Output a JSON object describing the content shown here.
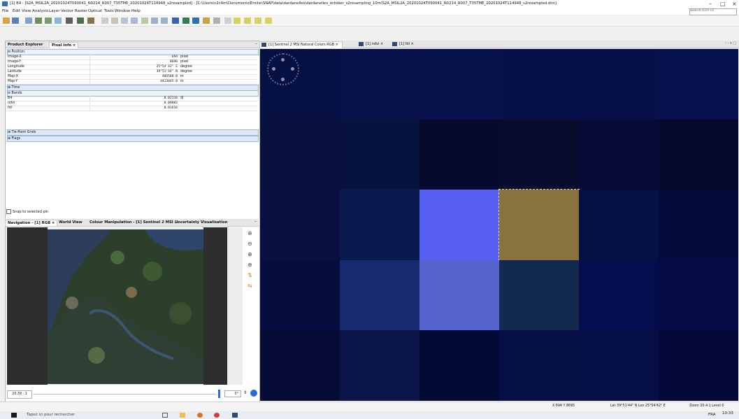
{
  "window": {
    "title": "[1] B4 - [S2A_MSIL2A_20201024T090041_N0214_R007_T35TME_20201024T114948_s2resampled] - [C:\\Users\\c2c4m\\Documents\\Emilie\\SNAP\\data\\dardanelles\\dardanelles_october_s2resampling_10m\\S2A_MSIL2A_20201024T090041_N0214_R007_T35TME_20201024T114948_s2resampled.dim]",
    "search_placeholder": "Search (Ctrl+I)"
  },
  "menu": [
    "File",
    "Edit",
    "View",
    "Analysis",
    "Layer",
    "Vector",
    "Raster",
    "Optical",
    "Tools",
    "Window",
    "Help"
  ],
  "left_panel": {
    "tabs": [
      "Product Explorer",
      "Pixel Info"
    ],
    "position_header": "Position",
    "position_rows": [
      {
        "name": "Image-X",
        "value": "694",
        "unit": "pixel"
      },
      {
        "name": "Image-Y",
        "value": "8696",
        "unit": "pixel"
      },
      {
        "name": "Longitude",
        "value": "25°54'42\" E",
        "unit": "degree"
      },
      {
        "name": "Latitude",
        "value": "39°51'44\" N",
        "unit": "degree"
      },
      {
        "name": "Map-X",
        "value": "406500.0",
        "unit": "m"
      },
      {
        "name": "Map-Y",
        "value": "4413045.0",
        "unit": "m"
      }
    ],
    "time_header": "Time",
    "bands_header": "Bands",
    "band_rows": [
      {
        "name": "B4",
        "value": "0.02110",
        "unit": "dl"
      },
      {
        "name": "ndvi",
        "value": "0.09082",
        "unit": ""
      },
      {
        "name": "fdi",
        "value": "0.01616",
        "unit": ""
      }
    ],
    "tiepoint_header": "Tie-Point Grids",
    "flags_header": "Flags",
    "snap_label": "Snap to selected pin"
  },
  "nav_panel": {
    "tabs": [
      "Navigation - [1] RGB",
      "World View",
      "Colour Manipulation - [1] Sentinel 2 MSI ...",
      "Uncertainty Visualisation"
    ],
    "scale": "20.39 : 1",
    "angle": "0°"
  },
  "image_tabs": [
    "[1] Sentinel 2 MSI Natural Colors RGB",
    "[1] ndvi",
    "[1] fdi"
  ],
  "pixel_grid": [
    [
      "#071043",
      "#08114a",
      "#08124a",
      "#071048",
      "#071049",
      "#081150"
    ],
    [
      "#08103d",
      "#08123f",
      "#060b2d",
      "#070c2d",
      "#050b34",
      "#050a2d"
    ],
    [
      "#071040",
      "#0a1a4e",
      "#575ef2",
      "#8a7240",
      "#061045",
      "#050b3d"
    ],
    [
      "#070d3e",
      "#162a70",
      "#5563cc",
      "#13294d",
      "#060d4f",
      "#060a45"
    ],
    [
      "#070c37",
      "#0a1446",
      "#040a36",
      "#071045",
      "#071046",
      "#05093a"
    ]
  ],
  "status_bar": {
    "xy": "X  694  Y  8695",
    "latlon": "Lat 39°51'44\" N  Lon 25°54'42\" E",
    "zoom": "Zoom 20.4:1  Level 0"
  },
  "taskbar": {
    "search_placeholder": "Tapez ici pour rechercher",
    "lang": "FRA",
    "time": "10:33"
  },
  "colors": {
    "accent": "#2a6bd6",
    "section_bg": "#dde9f8"
  }
}
